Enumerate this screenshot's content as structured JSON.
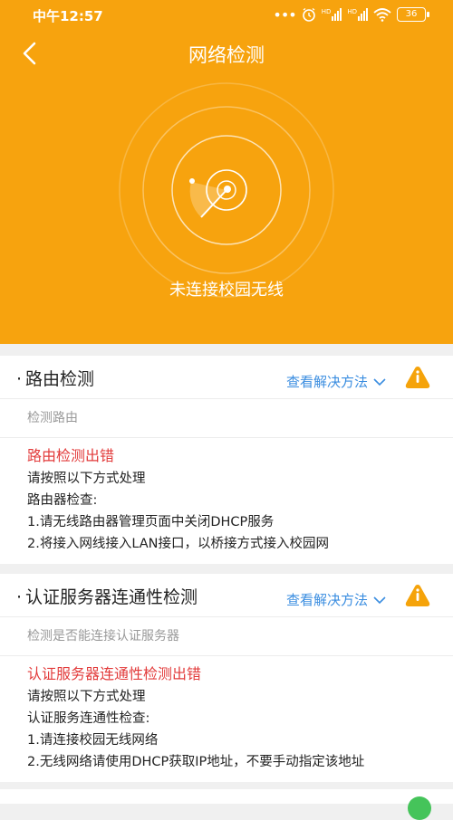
{
  "status_bar": {
    "time": "中午12:57",
    "signal1_label": "HD",
    "signal2_label": "HD",
    "battery": "36"
  },
  "header": {
    "title": "网络检测",
    "status": "未连接校园无线",
    "background_color": "#f7a30e"
  },
  "checks": [
    {
      "title": "路由检测",
      "solution_label": "查看解决方法",
      "subtitle": "检测路由",
      "error_title": "路由检测出错",
      "lines": [
        "请按照以下方式处理",
        "路由器检查:",
        "1.请无线路由器管理页面中关闭DHCP服务",
        "2.将接入网线接入LAN接口，以桥接方式接入校园网"
      ]
    },
    {
      "title": "认证服务器连通性检测",
      "solution_label": "查看解决方法",
      "subtitle": "检测是否能连接认证服务器",
      "error_title": "认证服务器连通性检测出错",
      "lines": [
        "请按照以下方式处理",
        "认证服务连通性检查:",
        "1.请连接校园无线网络",
        "2.无线网络请使用DHCP获取IP地址，不要手动指定该地址"
      ]
    }
  ],
  "colors": {
    "accent": "#f7a30e",
    "error": "#e23b3b",
    "link": "#3a8de0",
    "warning": "#f5a30a"
  }
}
